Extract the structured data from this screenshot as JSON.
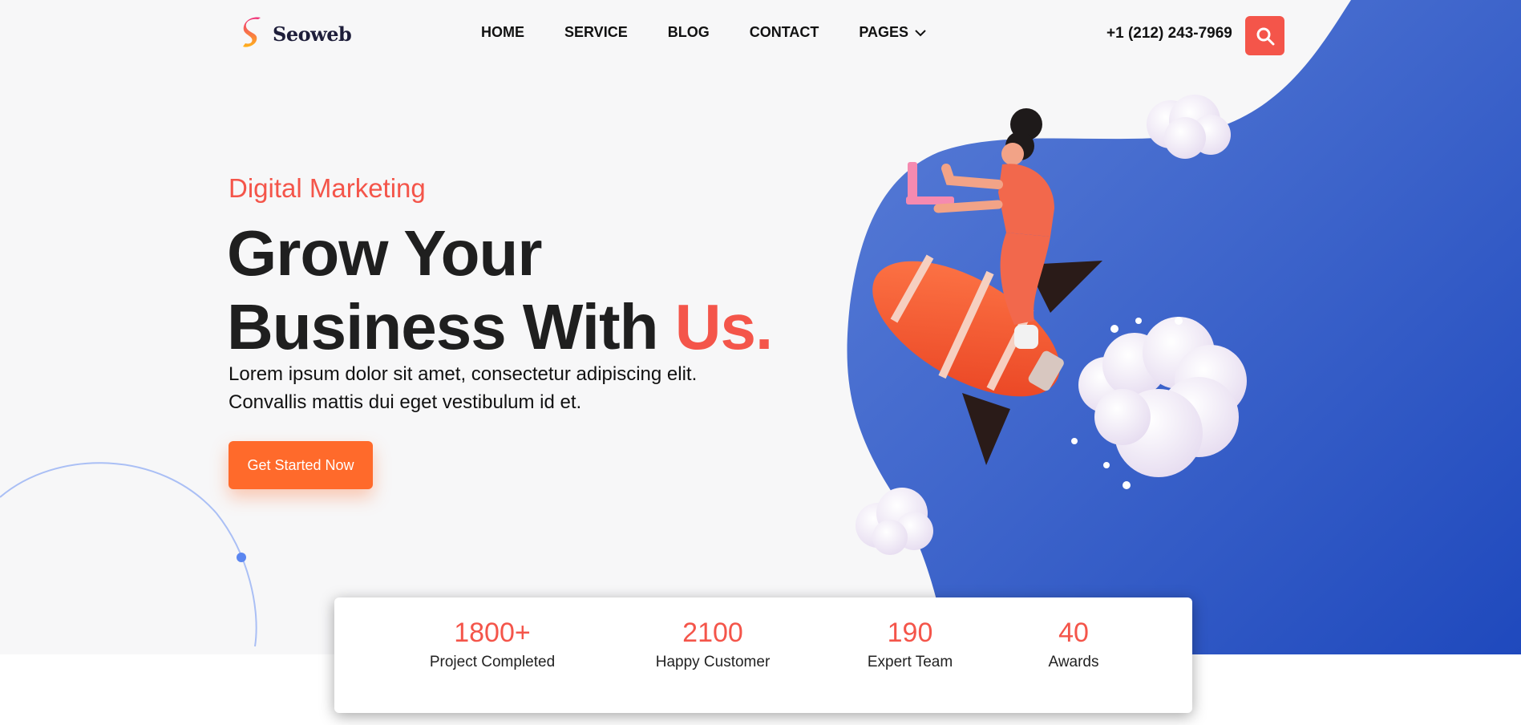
{
  "brand": {
    "name": "Seoweb",
    "accent": "#f4554a",
    "blue": "#2c55c7"
  },
  "nav": {
    "items": [
      {
        "label": "HOME"
      },
      {
        "label": "SERVICE"
      },
      {
        "label": "BLOG"
      },
      {
        "label": "CONTACT"
      },
      {
        "label": "PAGES",
        "icon": "chevron-down-icon"
      }
    ]
  },
  "header": {
    "phone": "+1 (212) 243-7969",
    "search_icon": "search-icon"
  },
  "hero": {
    "eyebrow": "Digital Marketing",
    "headline_line1": "Grow Your",
    "headline_line2": "Business With ",
    "headline_accent": "Us.",
    "lead_line1": "Lorem ipsum dolor sit amet, consectetur adipiscing elit.",
    "lead_line2": "Convallis mattis dui eget vestibulum id et.",
    "cta_label": "Get Started Now"
  },
  "stats": [
    {
      "value": "1800+",
      "label": "Project Completed"
    },
    {
      "value": "2100",
      "label": "Happy Customer"
    },
    {
      "value": "190",
      "label": "Expert Team"
    },
    {
      "value": "40",
      "label": "Awards"
    }
  ]
}
